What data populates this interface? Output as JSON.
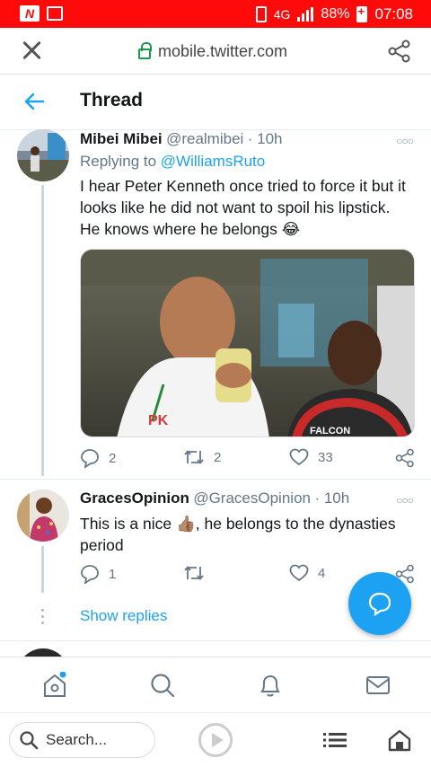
{
  "status_bar": {
    "network": "4G",
    "battery": "88%",
    "time": "07:08"
  },
  "url_bar": {
    "url": "mobile.twitter.com"
  },
  "header": {
    "title": "Thread"
  },
  "tweets": [
    {
      "name": "Mibei Mibei",
      "handle": "@realmibei",
      "time": "· 10h",
      "replying_prefix": "Replying to",
      "replying_to": "@WilliamsRuto",
      "text": "I hear Peter Kenneth once tried to force it but it looks like he did not want to spoil his lipstick. He knows where he belongs 😂",
      "image_letters": "PK",
      "image_shirt_text": "FALCON",
      "replies": "2",
      "retweets": "2",
      "likes": "33"
    },
    {
      "name": "GracesOpinion",
      "handle": "@GracesOpinion",
      "time": "· 10h",
      "text": "This is a nice 👍🏽, he belongs to the dynasties period",
      "replies": "1",
      "retweets": "",
      "likes": "4"
    }
  ],
  "show_replies": "Show replies",
  "browser": {
    "search_placeholder": "Search..."
  },
  "colors": {
    "status_bar": "#ff0a0a",
    "twitter_blue": "#1da1f2",
    "secondary_text": "#657786"
  }
}
